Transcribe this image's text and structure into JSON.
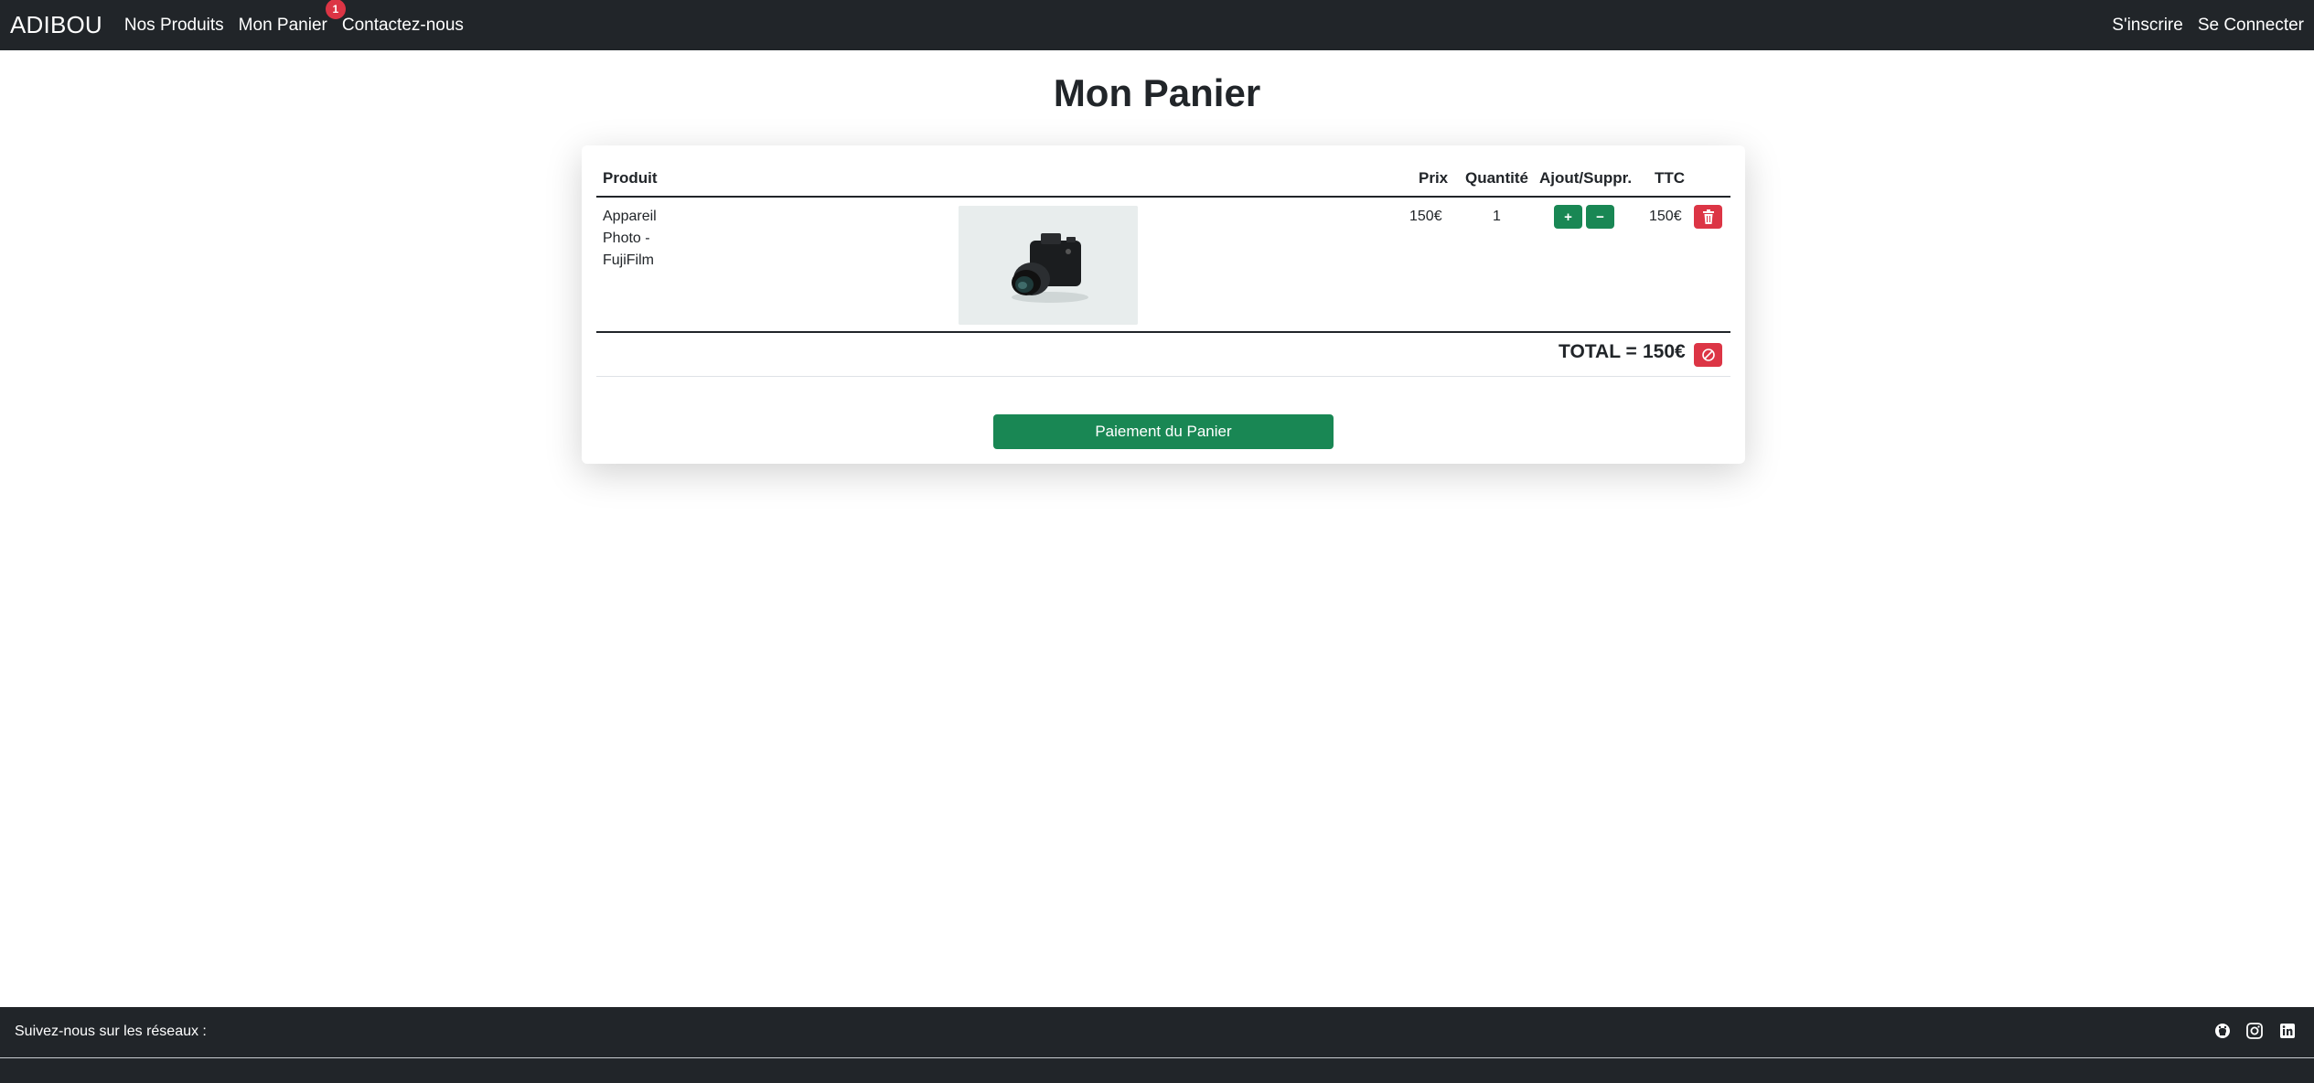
{
  "navbar": {
    "brand": "ADIBOU",
    "links": [
      "Nos Produits",
      "Mon Panier",
      "Contactez-nous"
    ],
    "cart_badge": "1",
    "right_links": [
      "S'inscrire",
      "Se Connecter"
    ]
  },
  "page": {
    "title": "Mon Panier"
  },
  "cart": {
    "headers": {
      "product": "Produit",
      "price": "Prix",
      "quantity": "Quantité",
      "add_remove": "Ajout/Suppr.",
      "ttc": "TTC"
    },
    "rows": [
      {
        "name": "Appareil Photo - FujiFilm",
        "image": "camera-photo",
        "price": "150€",
        "quantity": "1",
        "ttc": "150€"
      }
    ],
    "buttons": {
      "add": "+",
      "remove": "−"
    },
    "total_label": "TOTAL =",
    "total_value": "150€",
    "pay_button": "Paiement du Panier"
  },
  "footer": {
    "follow_text": "Suivez-nous sur les réseaux :",
    "social_icons": [
      "github-icon",
      "instagram-icon",
      "linkedin-icon"
    ]
  },
  "colors": {
    "navbar": "#212529",
    "success": "#198754",
    "danger": "#dc3545",
    "badge": "#dc3545"
  }
}
